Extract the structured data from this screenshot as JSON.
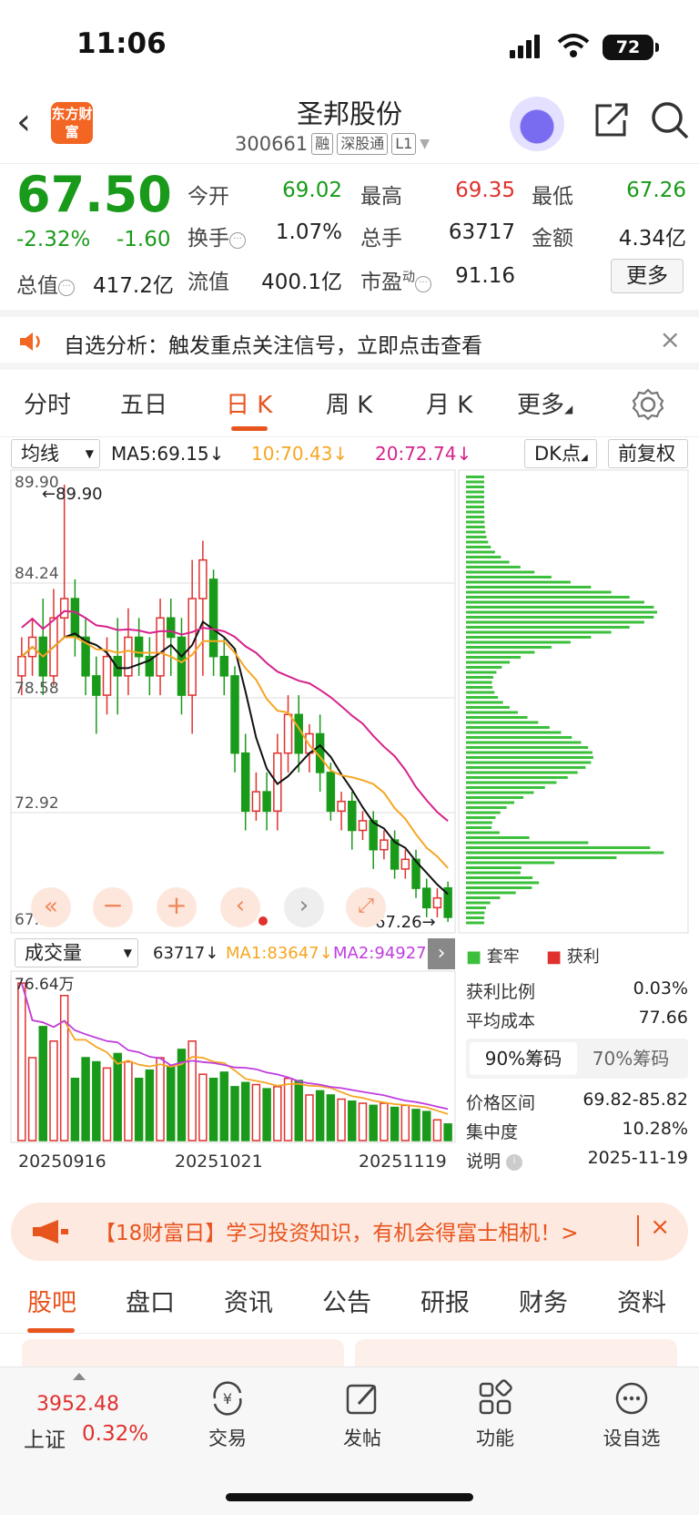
{
  "status": {
    "time": "11:06",
    "battery": "72"
  },
  "header": {
    "logo": "东方财富",
    "name": "圣邦股份",
    "code": "300661",
    "tags": [
      "融",
      "深股通",
      "L1"
    ]
  },
  "quote": {
    "price": "67.50",
    "pct": "-2.32%",
    "chg": "-1.60",
    "open_lbl": "今开",
    "open": "69.02",
    "high_lbl": "最高",
    "high": "69.35",
    "low_lbl": "最低",
    "low": "67.26",
    "turnover_lbl": "换手",
    "turnover": "1.07%",
    "vol_lbl": "总手",
    "vol": "63717",
    "amount_lbl": "金额",
    "amount": "4.34亿",
    "mcap_lbl": "总值",
    "mcap": "417.2亿",
    "float_lbl": "流值",
    "float": "400.1亿",
    "pe_lbl": "市盈",
    "pe_sup": "动",
    "pe": "91.16",
    "more": "更多",
    "colors": {
      "down": "#1a9a1a",
      "up": "#e0312f"
    }
  },
  "notice": {
    "text": "自选分析：触发重点关注信号，立即点击查看",
    "close": "×"
  },
  "period_tabs": [
    "分时",
    "五日",
    "日 K",
    "周 K",
    "月 K",
    "更多"
  ],
  "ma_bar": {
    "select": "均线",
    "ma5": "MA5:69.15↓",
    "ma10": "10:70.43↓",
    "ma20": "20:72.74↓",
    "dk": "DK点",
    "fq": "前复权"
  },
  "chart_data": {
    "type": "candlestick",
    "price_labels": [
      "89.90",
      "84.24",
      "78.58",
      "72.92",
      "67.26"
    ],
    "max_marker": "←89.90",
    "min_marker": "67.26→",
    "volume_labels": {
      "select": "成交量",
      "vol": "63717↓",
      "ma1": "MA1:83647↓",
      "ma2": "MA2:94927↓",
      "top": "76.64万"
    },
    "dates": [
      "20250916",
      "20251021",
      "20251119"
    ],
    "ylim": [
      67.26,
      89.9
    ],
    "candles": [
      [
        80,
        81,
        79,
        82
      ],
      [
        81,
        82,
        80,
        83
      ],
      [
        82,
        80,
        79,
        84
      ],
      [
        80,
        83,
        79.5,
        84.5
      ],
      [
        83,
        84,
        82,
        89.9
      ],
      [
        84,
        82,
        81,
        85
      ],
      [
        82,
        80,
        79,
        83
      ],
      [
        80,
        79,
        77,
        81
      ],
      [
        79,
        81,
        78,
        82
      ],
      [
        81,
        80,
        78,
        83
      ],
      [
        80,
        82,
        79,
        83.5
      ],
      [
        82,
        81,
        80,
        83
      ],
      [
        81,
        80,
        79,
        82
      ],
      [
        80,
        83,
        79,
        84
      ],
      [
        83,
        82,
        80,
        84
      ],
      [
        82,
        79,
        78,
        83
      ],
      [
        79,
        84,
        77,
        86
      ],
      [
        84,
        86,
        80,
        87
      ],
      [
        85,
        81,
        80,
        85.5
      ],
      [
        81,
        80,
        79,
        82
      ],
      [
        80,
        76,
        75,
        80.5
      ],
      [
        76,
        73,
        72,
        77
      ],
      [
        73,
        74,
        72.5,
        75
      ],
      [
        74,
        73,
        72,
        75
      ],
      [
        73,
        76,
        72,
        77
      ],
      [
        76,
        78,
        75,
        79
      ],
      [
        78,
        76,
        75,
        79
      ],
      [
        76,
        77,
        75,
        77.5
      ],
      [
        77,
        75,
        74,
        78
      ],
      [
        75,
        73,
        72.5,
        75.5
      ],
      [
        73,
        73.5,
        72,
        74
      ],
      [
        73.5,
        72,
        71,
        74
      ],
      [
        72,
        72.5,
        71.5,
        73
      ],
      [
        72.5,
        71,
        70,
        73
      ],
      [
        71,
        71.5,
        70.5,
        72
      ],
      [
        71.5,
        70,
        69.5,
        72
      ],
      [
        70,
        70.5,
        69.5,
        71
      ],
      [
        70.5,
        69,
        68.5,
        71
      ],
      [
        69,
        68,
        67.5,
        69.5
      ],
      [
        68,
        68.5,
        67.5,
        69
      ],
      [
        69.02,
        67.5,
        67.26,
        69.35
      ]
    ],
    "volumes": [
      76,
      40,
      55,
      48,
      70,
      30,
      40,
      38,
      35,
      42,
      38,
      30,
      34,
      40,
      36,
      44,
      48,
      32,
      30,
      33,
      26,
      28,
      27,
      25,
      26,
      30,
      29,
      22,
      24,
      22,
      20,
      19,
      18,
      17,
      18,
      16,
      17,
      15,
      14,
      10,
      8
    ],
    "chips": {
      "legend_hold": "套牢",
      "legend_profit": "获利"
    }
  },
  "chip_panel": {
    "profit_ratio_lbl": "获利比例",
    "profit_ratio": "0.03%",
    "avg_cost_lbl": "平均成本",
    "avg_cost": "77.66",
    "tab90": "90%筹码",
    "tab70": "70%筹码",
    "range_lbl": "价格区间",
    "range": "69.82-85.82",
    "conc_lbl": "集中度",
    "conc": "10.28%",
    "note_lbl": "说明",
    "date": "2025-11-19"
  },
  "promo": {
    "text": "【18财富日】学习投资知识，有机会得富士相机！>",
    "close": "×"
  },
  "section_tabs": [
    "股吧",
    "盘口",
    "资讯",
    "公告",
    "研报",
    "财务",
    "资料"
  ],
  "bottom_nav": {
    "index_val": "3952.48",
    "index_name": "上证",
    "index_pct": "0.32%",
    "items": [
      "交易",
      "发帖",
      "功能",
      "设自选"
    ]
  }
}
